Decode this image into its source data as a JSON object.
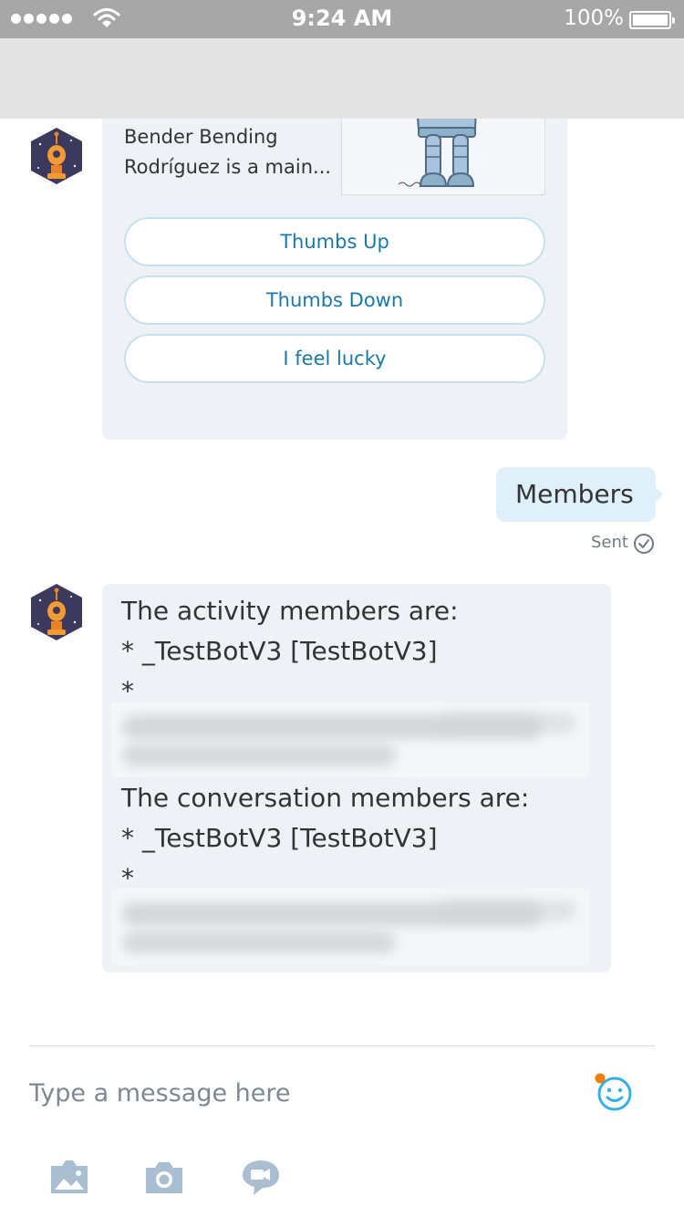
{
  "status_bar": {
    "time": "9:24 AM",
    "battery": "100%",
    "signal_icon": "signal-dots-icon",
    "wifi_icon": "wifi-icon",
    "battery_icon": "battery-icon"
  },
  "card": {
    "text_line1": "Bender Bending",
    "text_line2": "Rodríguez is a main...",
    "image": "bender-robot-image",
    "buttons": [
      "Thumbs Up",
      "Thumbs Down",
      "I feel lucky"
    ]
  },
  "user_message": {
    "text": "Members",
    "status": "Sent"
  },
  "bot_message": {
    "activity_heading": "The activity members are:",
    "activity_item": "* _TestBotV3 [TestBotV3]",
    "activity_item_redacted_prefix": "*",
    "conversation_heading": "The conversation members are:",
    "conversation_item": "* _TestBotV3 [TestBotV3]",
    "conversation_item_redacted_prefix": "*"
  },
  "compose": {
    "placeholder": "Type a message here",
    "emoji_icon": "smiley-icon",
    "tools": [
      "image-icon",
      "camera-icon",
      "video-chat-icon"
    ]
  },
  "colors": {
    "accent": "#1a7aa6",
    "bubble_user": "#dff0fb",
    "bubble_bot": "#eef2f7",
    "status_bar": "#a7a7a7",
    "nav_bar": "#e4e4e4",
    "notification_dot": "#f57c00"
  }
}
